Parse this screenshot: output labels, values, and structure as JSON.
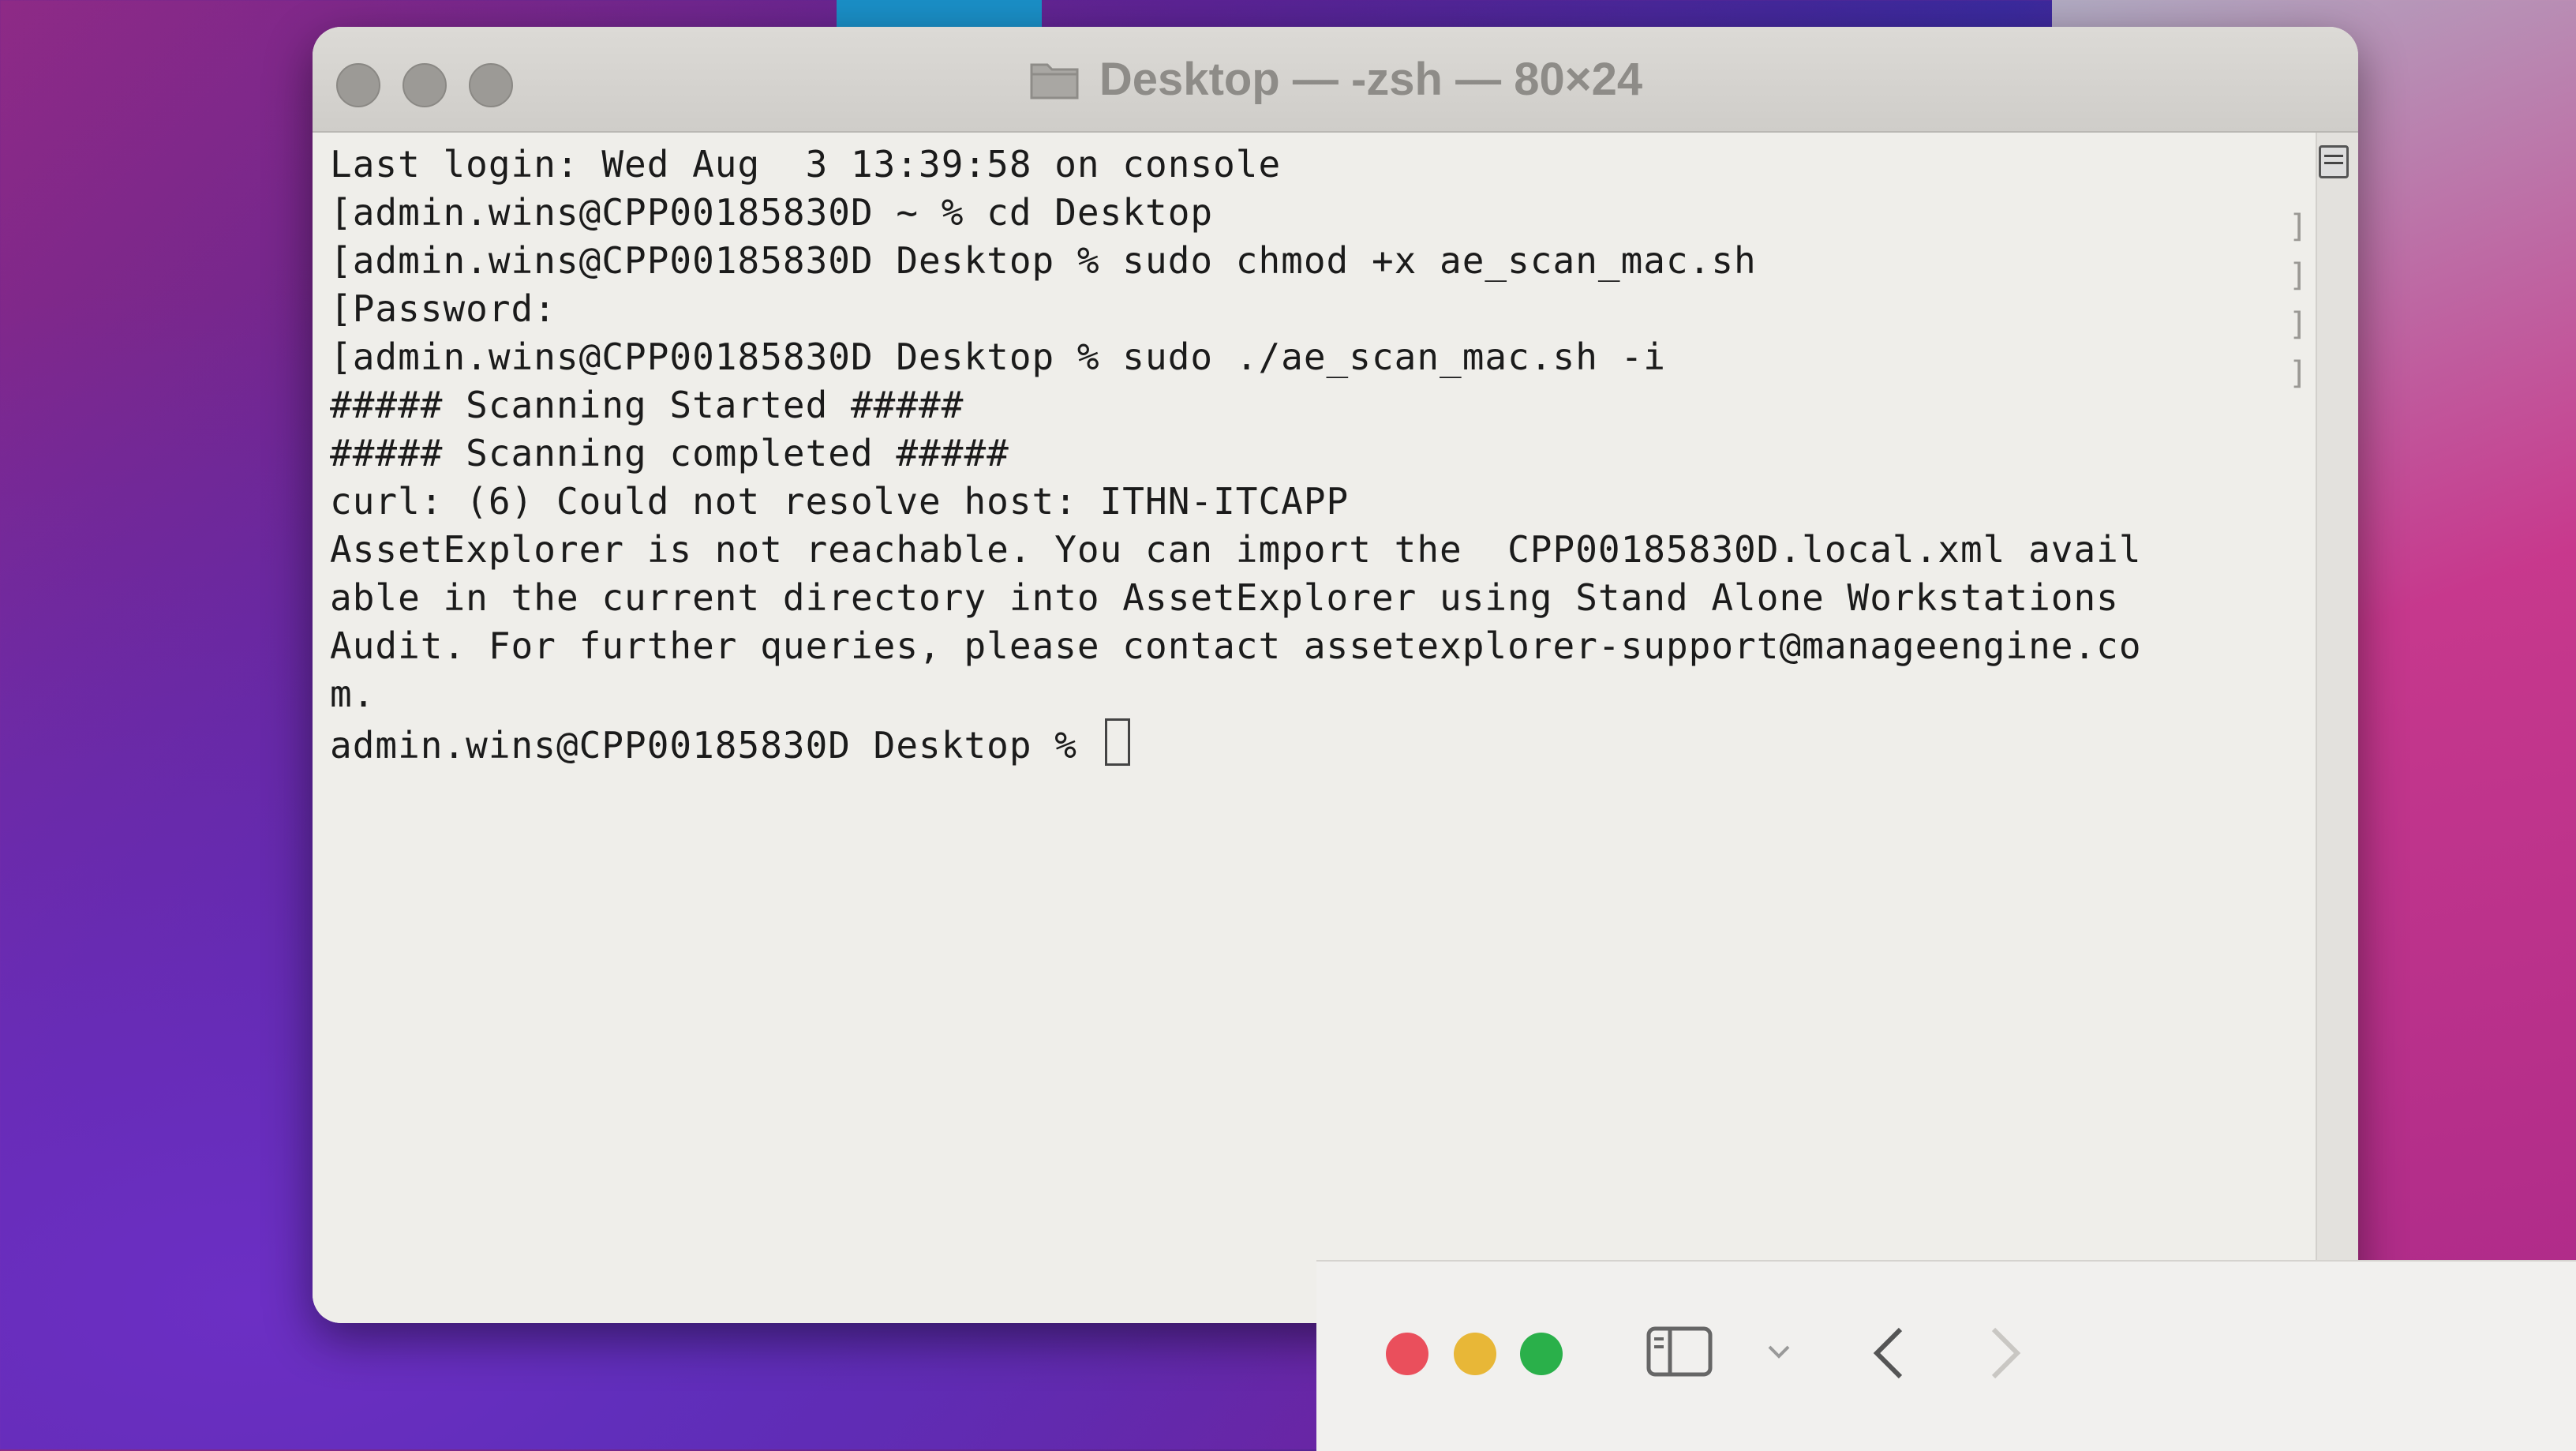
{
  "window": {
    "title": "Desktop — -zsh — 80×24",
    "icon": "folder-icon"
  },
  "terminal": {
    "lines": [
      "Last login: Wed Aug  3 13:39:58 on console",
      "[admin.wins@CPP00185830D ~ % cd Desktop",
      "[admin.wins@CPP00185830D Desktop % sudo chmod +x ae_scan_mac.sh",
      "[Password:",
      "[admin.wins@CPP00185830D Desktop % sudo ./ae_scan_mac.sh -i",
      "##### Scanning Started #####",
      "##### Scanning completed #####",
      "curl: (6) Could not resolve host: ITHN-ITCAPP",
      "AssetExplorer is not reachable. You can import the  CPP00185830D.local.xml avail",
      "able in the current directory into AssetExplorer using Stand Alone Workstations",
      "Audit. For further queries, please contact assetexplorer-support@manageengine.co",
      "m."
    ],
    "prompt": "admin.wins@CPP00185830D Desktop % "
  },
  "colors": {
    "close": "#ea4f5c",
    "minimize": "#e8b737",
    "maximize": "#2ab04a",
    "terminal_bg": "#efeeea"
  },
  "icons": {
    "sidebar": "sidebar-toggle-icon",
    "dropdown": "chevron-down-icon",
    "back": "chevron-left-icon",
    "forward": "chevron-right-icon"
  }
}
